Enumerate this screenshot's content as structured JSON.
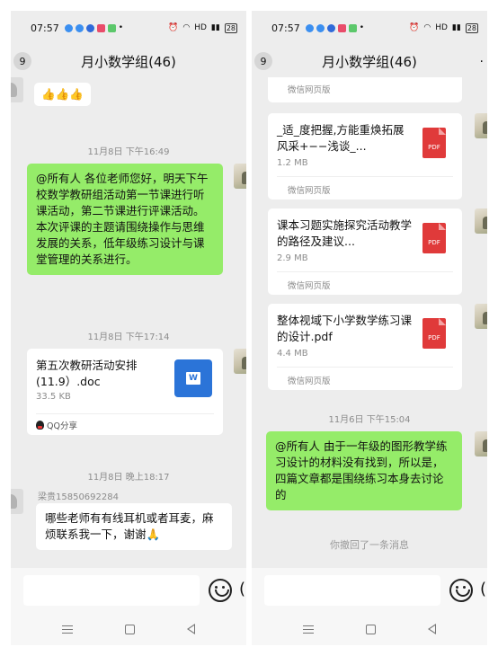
{
  "left": {
    "status": {
      "time": "07:57",
      "battery": "28"
    },
    "header": {
      "back_count": "9",
      "title": "月小数学组(46)"
    },
    "messages": {
      "emoji_bubble": "👍👍👍",
      "time1": "11月8日 下午16:49",
      "announcement": "@所有人  各位老师您好，明天下午校数学教研组活动第一节课进行听课活动，第二节课进行评课活动。本次评课的主题请围绕操作与思维发展的关系，低年级练习设计与课堂管理的关系进行。",
      "time2": "11月8日 下午17:14",
      "doc_file": {
        "name": "第五次教研活动安排(11.9）.doc",
        "size": "33.5 KB",
        "source": "QQ分享",
        "icon": "word-icon"
      },
      "time3": "11月8日 晚上18:17",
      "sender": "梁贵15850692284",
      "question": "哪些老师有有线耳机或者耳麦，麻烦联系我一下，谢谢🙏"
    }
  },
  "right": {
    "status": {
      "time": "07:57",
      "battery": "28"
    },
    "header": {
      "back_count": "9",
      "title": "月小数学组(46)"
    },
    "messages": {
      "source_top": "微信网页版",
      "files": [
        {
          "name": "_适_度把握,方能重焕拓展风采+−−浅谈_...",
          "size": "1.2 MB",
          "source": "微信网页版",
          "icon": "pdf-icon"
        },
        {
          "name": "课本习题实施探究活动教学的路径及建议...",
          "size": "2.9 MB",
          "source": "微信网页版",
          "icon": "pdf-icon"
        },
        {
          "name": "整体视域下小学数学练习课的设计.pdf",
          "size": "4.4 MB",
          "source": "微信网页版",
          "icon": "pdf-icon"
        }
      ],
      "time1": "11月6日 下午15:04",
      "announcement": "@所有人  由于一年级的图形教学练习设计的材料没有找到，所以是，四篇文章都是围绕练习本身去讨论的",
      "recall_note": "你撤回了一条消息"
    }
  },
  "pdf_label": "PDF",
  "word_label": "W",
  "colors": {
    "green_bubble": "#95ec69",
    "chat_bg": "#ededed",
    "pdf_red": "#e03a3a",
    "word_blue": "#2b74d8"
  }
}
